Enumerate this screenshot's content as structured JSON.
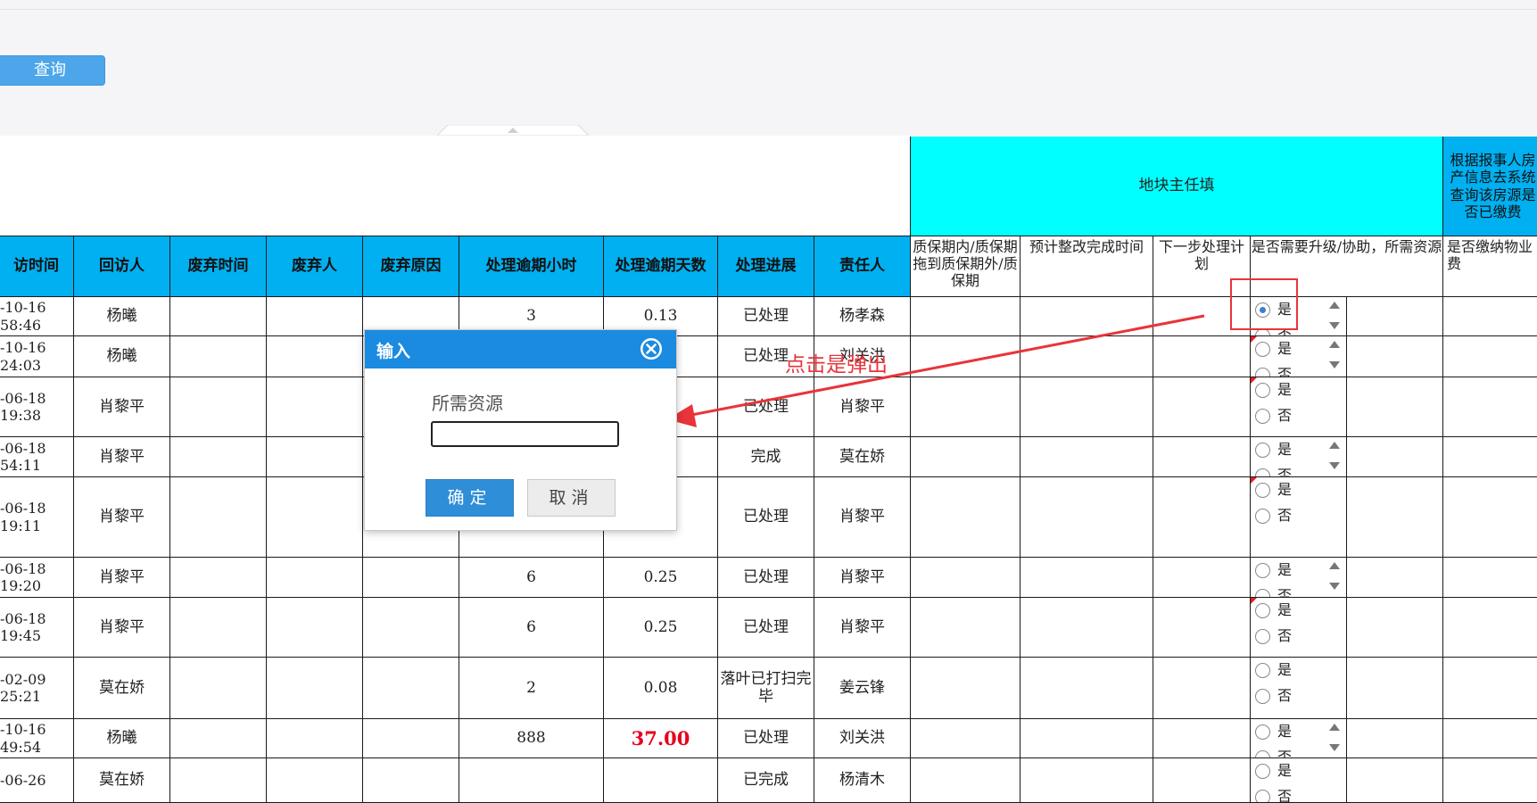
{
  "toolbar": {
    "query_label": "查询"
  },
  "group_headers": {
    "district_manager": "地块主任填",
    "check_paid": "根据报事人房产信息去系统查询该房源是否已缴费"
  },
  "columns": {
    "visit_time": "访时间",
    "visitor": "回访人",
    "discard_time": "废弃时间",
    "discarder": "废弃人",
    "discard_reason": "废弃原因",
    "overdue_hours": "处理逾期小时",
    "overdue_days": "处理逾期天数",
    "progress": "处理进展",
    "owner": "责任人",
    "warranty": "质保期内/质保期拖到质保期外/质保期",
    "est_time": "预计整改完成时间",
    "next_plan": "下一步处理计划",
    "need_upgrade": "是否需要升级/协助，所需资源",
    "paid_fee": "是否缴纳物业费"
  },
  "rows": [
    {
      "date": "-10-16",
      "time": "58:46",
      "visitor": "杨曦",
      "hours": "3",
      "days": "0.13",
      "progress": "已处理",
      "owner": "杨孝森"
    },
    {
      "date": "-10-16",
      "time": "24:03",
      "visitor": "杨曦",
      "hours": "",
      "days": "",
      "progress": "已处理",
      "owner": "刘关洪"
    },
    {
      "date": "-06-18",
      "time": "19:38",
      "visitor": "肖黎平",
      "hours": "",
      "days": "",
      "progress": "已处理",
      "owner": "肖黎平"
    },
    {
      "date": "-06-18",
      "time": "54:11",
      "visitor": "肖黎平",
      "hours": "",
      "days": "",
      "progress": "完成",
      "owner": "莫在娇"
    },
    {
      "date": "-06-18",
      "time": "19:11",
      "visitor": "肖黎平",
      "hours": "",
      "days": "",
      "progress": "已处理",
      "owner": "肖黎平"
    },
    {
      "date": "-06-18",
      "time": "19:20",
      "visitor": "肖黎平",
      "hours": "6",
      "days": "0.25",
      "progress": "已处理",
      "owner": "肖黎平"
    },
    {
      "date": "-06-18",
      "time": "19:45",
      "visitor": "肖黎平",
      "hours": "6",
      "days": "0.25",
      "progress": "已处理",
      "owner": "肖黎平"
    },
    {
      "date": "-02-09",
      "time": "25:21",
      "visitor": "莫在娇",
      "hours": "2",
      "days": "0.08",
      "progress": "落叶已打扫完毕",
      "owner": "姜云锋"
    },
    {
      "date": "-10-16",
      "time": "49:54",
      "visitor": "杨曦",
      "hours": "888",
      "days": "37.00",
      "progress": "已处理",
      "owner": "刘关洪"
    },
    {
      "date": "-06-26",
      "time": "",
      "visitor": "莫在娇",
      "hours": "",
      "days": "",
      "progress": "已完成",
      "owner": "杨清木"
    }
  ],
  "radio": {
    "yes": "是",
    "no": "否"
  },
  "annotation": {
    "text": "点击是弹出"
  },
  "dialog": {
    "title": "输入",
    "field_label": "所需资源",
    "field_value": "",
    "ok_label": "确定",
    "cancel_label": "取消"
  },
  "colors": {
    "header_blue": "#00b0f0",
    "group_cyan": "#00ffff",
    "dialog_blue": "#1a8be0",
    "annotation_red": "#e8343a"
  }
}
